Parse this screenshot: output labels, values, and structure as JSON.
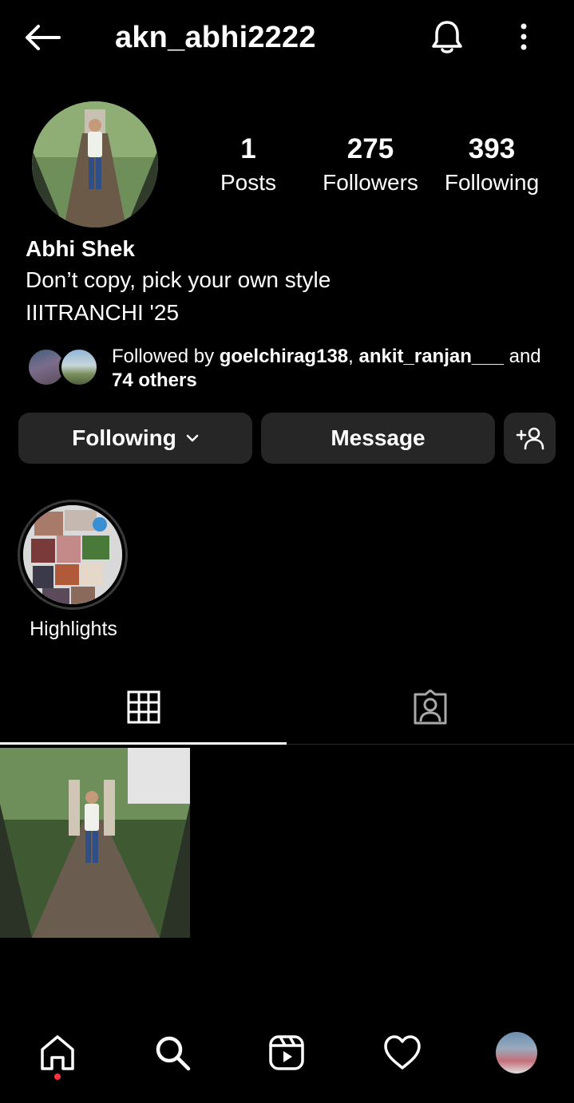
{
  "header": {
    "username": "akn_abhi2222",
    "icons": [
      "back-arrow-icon",
      "bell-icon",
      "more-vertical-icon"
    ]
  },
  "profile": {
    "display_name": "Abhi Shek",
    "bio_line1": "Don’t copy, pick your own style",
    "bio_line2": "IIITRANCHI '25"
  },
  "stats": {
    "posts": {
      "count": "1",
      "label": "Posts"
    },
    "followers": {
      "count": "275",
      "label": "Followers"
    },
    "following": {
      "count": "393",
      "label": "Following"
    }
  },
  "followed_by": {
    "prefix": "Followed by ",
    "user1": "goelchirag138",
    "sep": ", ",
    "user2": "ankit_ranjan___",
    "suffix": " and",
    "others": "74 others"
  },
  "actions": {
    "following_label": "Following",
    "message_label": "Message",
    "add_user_icon": "add-person-icon"
  },
  "highlights": [
    {
      "label": "Highlights"
    }
  ],
  "tabs": [
    {
      "name": "posts-grid",
      "icon": "grid-icon",
      "active": true
    },
    {
      "name": "tagged",
      "icon": "tagged-person-icon",
      "active": false
    }
  ],
  "bottom_nav": {
    "items": [
      "home-icon",
      "search-icon",
      "reels-icon",
      "heart-icon",
      "profile-avatar"
    ],
    "home_has_notification": true,
    "notification_color": "#ff3040"
  },
  "colors": {
    "background": "#000000",
    "button_bg": "#262626",
    "text": "#ffffff"
  }
}
